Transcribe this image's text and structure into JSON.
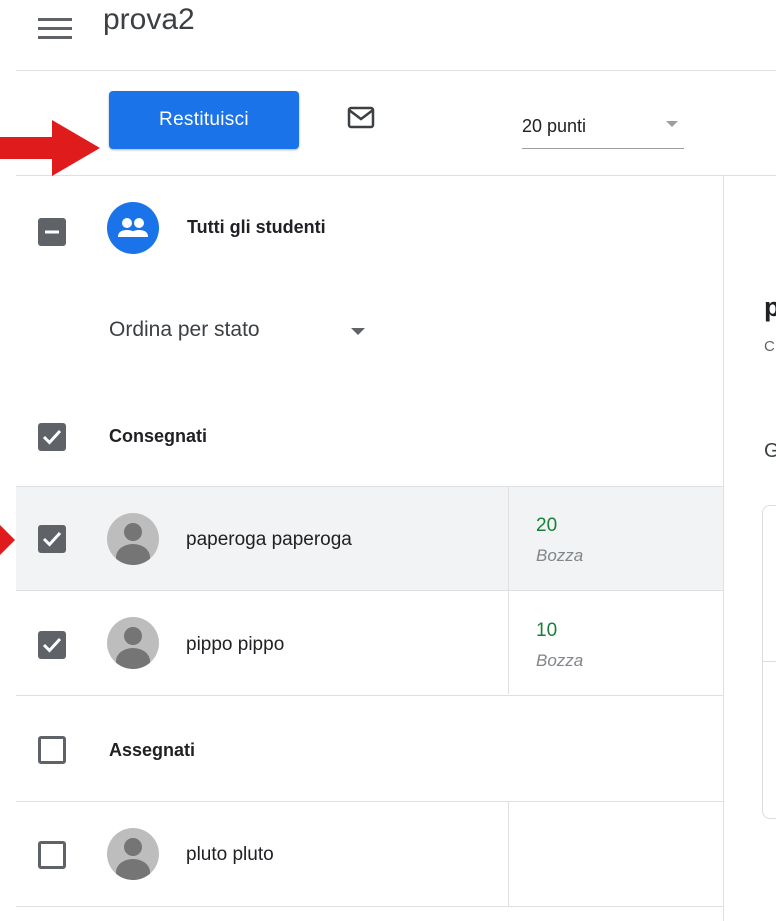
{
  "header": {
    "title": "prova2"
  },
  "toolbar": {
    "return_label": "Restituisci",
    "points_value": "20 punti"
  },
  "list": {
    "all_students_label": "Tutti gli studenti",
    "sort_label": "Ordina per stato",
    "sections": [
      {
        "label": "Consegnati",
        "checked": true,
        "students": [
          {
            "name": "paperoga paperoga",
            "grade": "20",
            "status": "Bozza",
            "checked": true
          },
          {
            "name": "pippo pippo",
            "grade": "10",
            "status": "Bozza",
            "checked": true
          }
        ]
      },
      {
        "label": "Assegnati",
        "checked": false,
        "students": [
          {
            "name": "pluto pluto",
            "grade": "",
            "status": "",
            "checked": false
          }
        ]
      }
    ]
  },
  "right_pane": {
    "title_fragment": "p",
    "subtitle_fragment": "C",
    "section_fragment": "G"
  },
  "colors": {
    "accent": "#1a73e8",
    "grade_green": "#188038",
    "arrow_red": "#e01b1b"
  }
}
